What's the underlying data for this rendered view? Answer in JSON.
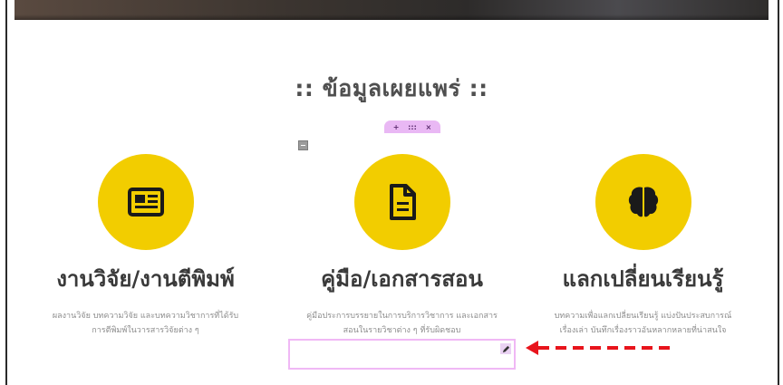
{
  "section": {
    "title": ":: ข้อมูลเผยแพร่ ::"
  },
  "editor_toolbar": {
    "add": "+",
    "move": ":::",
    "close": "×"
  },
  "columns": [
    {
      "icon": "newspaper-icon",
      "heading": "งานวิจัย/งานตีพิมพ์",
      "line1": "ผลงานวิจัย บทความวิจัย และบทความวิชาการที่ได้รับ",
      "line2": "การตีพิมพ์ในวารสารวิจัยต่าง ๆ"
    },
    {
      "icon": "document-icon",
      "heading": "คู่มือ/เอกสารสอน",
      "line1": "คู่มือประการบรรยายในการบริการวิชาการ และเอกสาร",
      "line2": "สอนในรายวิชาต่าง ๆ ที่รับผิดชอบ"
    },
    {
      "icon": "brain-icon",
      "heading": "แลกเปลี่ยนเรียนรู้",
      "line1": "บทความเพื่อแลกเปลี่ยนเรียนรู้ แบ่งปันประสบการณ์",
      "line2": "เรื่องเล่า บันทึกเรื่องราวอันหลากหลายที่น่าสนใจ"
    }
  ],
  "colors": {
    "accent": "#f2cd00",
    "editor_highlight": "#f0b8f5",
    "arrow": "#e8141c"
  }
}
